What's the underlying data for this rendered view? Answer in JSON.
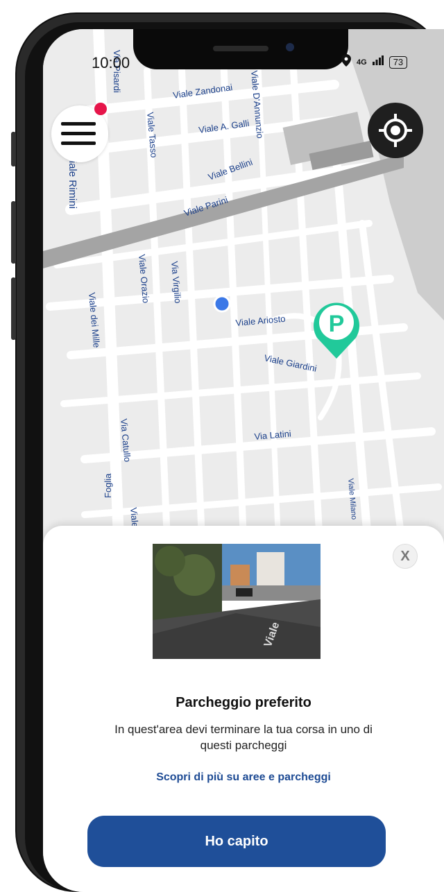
{
  "status_bar": {
    "time": "10:00",
    "network": "4G",
    "battery": "73"
  },
  "map": {
    "streets": [
      "Viale Zandonai",
      "Viale A. Galli",
      "Viale Bellini",
      "Viale Parini",
      "Viale Rimini",
      "Viale Tasso",
      "Viale D'Annunzio",
      "Via Pisardi",
      "Viale Orazio",
      "Via Virgilio",
      "Viale Ariosto",
      "Viale dei Mille",
      "Viale Giardini",
      "Via Catullo",
      "Via Latini",
      "Viale Milano",
      "Foglia",
      "Viale"
    ],
    "parking_marker_letter": "P",
    "colors": {
      "road": "#ffffff",
      "block": "#ececec",
      "railway": "#a4a4a4",
      "building": "#bfbfbf",
      "water": "#c9c9c9",
      "user_dot": "#3b78e7",
      "parking": "#21c99a"
    }
  },
  "controls": {
    "menu_icon": "hamburger-menu-icon",
    "notification_color": "#e6154a",
    "locate_icon": "crosshair-icon"
  },
  "sheet": {
    "close_label": "X",
    "title": "Parcheggio preferito",
    "description": "In quest'area devi terminare la tua corsa in uno di questi parcheggi",
    "link": "Scopri di più su aree e parcheggi",
    "button": "Ho capito",
    "accent": "#1f4f99",
    "photo_overlay_text": "Viale"
  }
}
